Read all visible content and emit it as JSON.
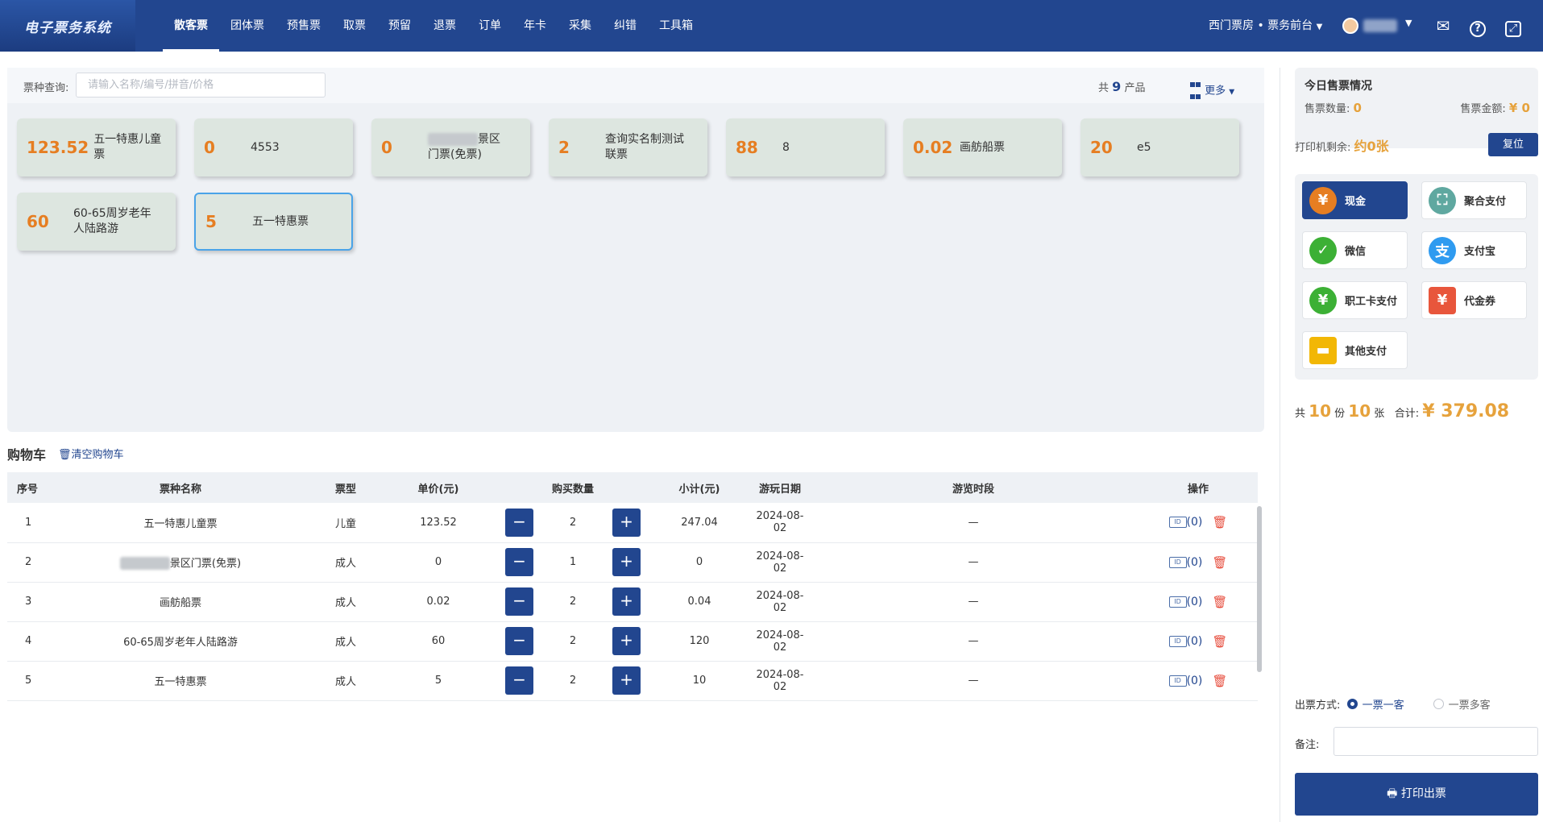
{
  "header": {
    "logo": "电子票务系统",
    "nav": [
      "散客票",
      "团体票",
      "预售票",
      "取票",
      "预留",
      "退票",
      "订单",
      "年卡",
      "采集",
      "纠错",
      "工具箱"
    ],
    "store": "西门票房 • 票务前台",
    "icons": [
      "mail-icon",
      "help-icon",
      "fullscreen-icon"
    ]
  },
  "search": {
    "label": "票种查询:",
    "placeholder": "请输入名称/编号/拼音/价格",
    "count_prefix": "共",
    "count": "9",
    "count_suffix": "产品",
    "more": "更多"
  },
  "products": [
    {
      "price": "123.52",
      "name": "五一特惠儿童票"
    },
    {
      "price": "0",
      "name": "4553"
    },
    {
      "price": "0",
      "name": "景区门票(免票)"
    },
    {
      "price": "2",
      "name": "查询实名制测试联票"
    },
    {
      "price": "88",
      "name": "8"
    },
    {
      "price": "0.02",
      "name": "画舫船票"
    },
    {
      "price": "20",
      "name": "e5"
    },
    {
      "price": "60",
      "name": "60-65周岁老年人陆路游"
    },
    {
      "price": "5",
      "name": "五一特惠票"
    }
  ],
  "cart": {
    "title": "购物车",
    "clear": "清空购物车",
    "columns": [
      "序号",
      "票种名称",
      "票型",
      "单价(元)",
      "购买数量",
      "小计(元)",
      "游玩日期",
      "游览时段",
      "操作"
    ],
    "rows": [
      {
        "no": "1",
        "name": "五一特惠儿童票",
        "type": "儿童",
        "price": "123.52",
        "qty": "2",
        "subtotal": "247.04",
        "date": "2024-08-02",
        "slot": "—",
        "count": "(0)"
      },
      {
        "no": "2",
        "name": "景区门票(免票)",
        "type": "成人",
        "price": "0",
        "qty": "1",
        "subtotal": "0",
        "date": "2024-08-02",
        "slot": "—",
        "count": "(0)"
      },
      {
        "no": "3",
        "name": "画舫船票",
        "type": "成人",
        "price": "0.02",
        "qty": "2",
        "subtotal": "0.04",
        "date": "2024-08-02",
        "slot": "—",
        "count": "(0)"
      },
      {
        "no": "4",
        "name": "60-65周岁老年人陆路游",
        "type": "成人",
        "price": "60",
        "qty": "2",
        "subtotal": "120",
        "date": "2024-08-02",
        "slot": "—",
        "count": "(0)"
      },
      {
        "no": "5",
        "name": "五一特惠票",
        "type": "成人",
        "price": "5",
        "qty": "2",
        "subtotal": "10",
        "date": "2024-08-02",
        "slot": "—",
        "count": "(0)"
      }
    ]
  },
  "today": {
    "title": "今日售票情况",
    "qty_label": "售票数量:",
    "qty": "0",
    "amount_label": "售票金额:",
    "amount": "¥ 0"
  },
  "printer": {
    "label": "打印机剩余:",
    "value": "约0张",
    "reset": "复位"
  },
  "payments": [
    {
      "label": "现金",
      "icon": "cash-icon",
      "color": "#e67e22",
      "glyph": "¥"
    },
    {
      "label": "聚合支付",
      "icon": "scan-icon",
      "color": "#5fa8a0",
      "glyph": "⛶"
    },
    {
      "label": "微信",
      "icon": "wechat-icon",
      "color": "#3cb035",
      "glyph": "✓"
    },
    {
      "label": "支付宝",
      "icon": "alipay-icon",
      "color": "#2f9bf0",
      "glyph": "支"
    },
    {
      "label": "职工卡支付",
      "icon": "staff-card-icon",
      "color": "#3cb035",
      "glyph": "¥"
    },
    {
      "label": "代金券",
      "icon": "voucher-icon",
      "color": "#e8563c",
      "glyph": "¥"
    },
    {
      "label": "其他支付",
      "icon": "wallet-icon",
      "color": "#f2b705",
      "glyph": "▬"
    }
  ],
  "total": {
    "p1": "共",
    "parts": "10",
    "p2": "份",
    "sheets": "10",
    "p3": "张",
    "p4": "合计:",
    "amount": "¥ 379.08"
  },
  "issue": {
    "label": "出票方式:",
    "opt1": "一票一客",
    "opt2": "一票多客"
  },
  "note": {
    "label": "备注:"
  },
  "print": {
    "label": "打印出票"
  }
}
